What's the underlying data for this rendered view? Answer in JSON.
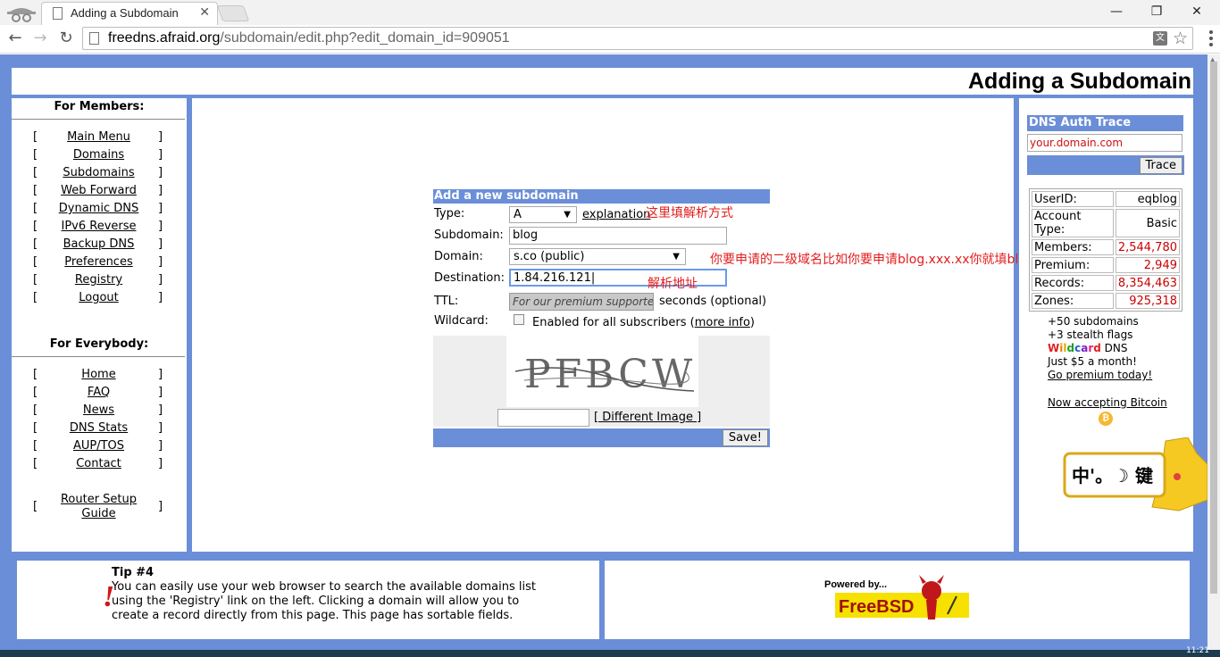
{
  "browser": {
    "tab_title": "Adding a Subdomain",
    "tab_close": "✕",
    "url_host": "freedns.afraid.org",
    "url_path": "/subdomain/edit.php?edit_domain_id=909051",
    "minimize": "—",
    "maximize": "❐",
    "close": "✕"
  },
  "page": {
    "title": "Adding a Subdomain"
  },
  "sidebar": {
    "members_heading": "For Members:",
    "members_items": [
      "Main Menu",
      "Domains",
      "Subdomains",
      "Web Forward",
      "Dynamic DNS",
      "IPv6 Reverse",
      "Backup DNS",
      "Preferences",
      "Registry",
      "Logout"
    ],
    "everybody_heading": "For Everybody:",
    "everybody_items": [
      "Home",
      "FAQ",
      "News",
      "DNS Stats",
      "AUP/TOS",
      "Contact"
    ],
    "router_setup_line1": "Router Setup",
    "router_setup_line2": "Guide",
    "bracket_open": "[",
    "bracket_close": "]"
  },
  "form": {
    "heading": "Add a new subdomain",
    "type_label": "Type:",
    "type_value": "A",
    "explanation_link": "explanation",
    "subdomain_label": "Subdomain:",
    "subdomain_value": "blog",
    "domain_label": "Domain:",
    "domain_value": "s.co (public)",
    "destination_label": "Destination:",
    "destination_value": "1.84.216.121",
    "ttl_label": "TTL:",
    "ttl_placeholder": "For our premium supporters",
    "ttl_suffix": "seconds (optional)",
    "wildcard_label": "Wildcard:",
    "wildcard_text": "Enabled for all subscribers (",
    "wildcard_more": "more info",
    "wildcard_close": ")",
    "captcha_text": "PFBCW",
    "different_image": "[ Different Image ]",
    "save_button": "Save!"
  },
  "annotations": {
    "type_note": "这里填解析方式",
    "domain_note": "你要申请的二级域名比如你要申请blog.xxx.xx你就填blog",
    "destination_note": "解析地址"
  },
  "rightpanel": {
    "trace_heading": "DNS Auth Trace",
    "trace_input_value": "your.domain.com",
    "trace_button": "Trace",
    "stats": [
      {
        "label": "UserID:",
        "value": "eqblog"
      },
      {
        "label": "Account Type:",
        "value": "Basic"
      },
      {
        "label": "Members:",
        "value": "2,544,780"
      },
      {
        "label": "Premium:",
        "value": "2,949"
      },
      {
        "label": "Records:",
        "value": "8,354,463"
      },
      {
        "label": "Zones:",
        "value": "925,318"
      }
    ],
    "promo_line1": "+50 subdomains",
    "promo_line2": "+3 stealth flags",
    "promo_wildcard": "Wildcard",
    "promo_dns": " DNS",
    "promo_line4": "Just $5 a month!",
    "promo_link": "Go premium today!",
    "bitcoin_link": "Now accepting Bitcoin",
    "bitcoin_symbol": "₿"
  },
  "ime": {
    "text": "中'。☽ 键"
  },
  "footer": {
    "tip_title": "Tip #4",
    "tip_text": "You can easily use your web browser to search the available domains list using the 'Registry' link on the left. Clicking a domain will allow you to create a record directly from this page. This page has sortable fields.",
    "bang": "!",
    "freebsd_powered": "Powered by...",
    "freebsd_name": "FreeBSD"
  },
  "taskbar": {
    "clock": "11:21"
  }
}
